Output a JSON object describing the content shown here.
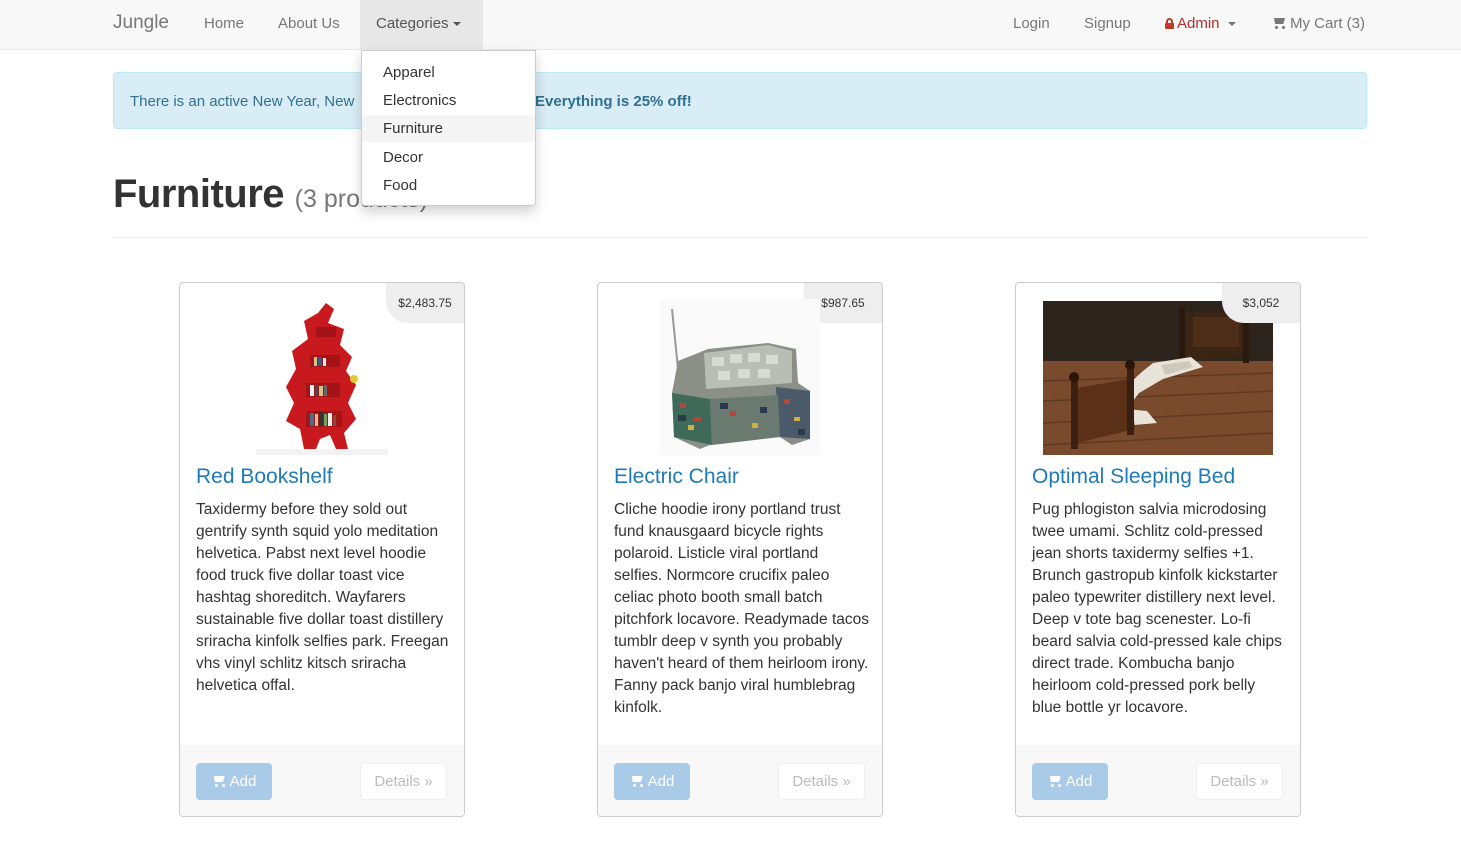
{
  "navbar": {
    "brand": "Jungle",
    "home": "Home",
    "about": "About Us",
    "categories": "Categories",
    "login": "Login",
    "signup": "Signup",
    "admin": "Admin",
    "cart": "My Cart (3)"
  },
  "dropdown": {
    "items": [
      "Apparel",
      "Electronics",
      "Furniture",
      "Decor",
      "Food"
    ],
    "active": "Furniture"
  },
  "alert": {
    "prefix": "There is an active New Year, New",
    "bold": "Everything is 25% off!"
  },
  "page": {
    "title": "Furniture",
    "count": "(3 products)"
  },
  "products": [
    {
      "name": "Red Bookshelf",
      "price": "$2,483.75",
      "description": "Taxidermy before they sold out gentrify synth squid yolo meditation helvetica. Pabst next level hoodie food truck five dollar toast vice hashtag shoreditch. Wayfarers sustainable five dollar toast distillery sriracha kinfolk selfies park. Freegan vhs vinyl schlitz kitsch sriracha helvetica offal.",
      "add": "Add",
      "details": "Details »"
    },
    {
      "name": "Electric Chair",
      "price": "$987.65",
      "description": "Cliche hoodie irony portland trust fund knausgaard bicycle rights polaroid. Listicle viral portland selfies. Normcore crucifix paleo celiac photo booth small batch pitchfork locavore. Readymade tacos tumblr deep v synth you probably haven't heard of them heirloom irony. Fanny pack banjo viral humblebrag kinfolk.",
      "add": "Add",
      "details": "Details »"
    },
    {
      "name": "Optimal Sleeping Bed",
      "price": "$3,052",
      "description": "Pug phlogiston salvia microdosing twee umami. Schlitz cold-pressed jean shorts taxidermy selfies +1. Brunch gastropub kinfolk kickstarter paleo typewriter distillery next level. Deep v tote bag scenester. Lo-fi beard salvia cold-pressed kale chips direct trade. Kombucha banjo heirloom cold-pressed pork belly blue bottle yr locavore.",
      "add": "Add",
      "details": "Details »"
    }
  ],
  "colors": {
    "link": "#1f7ab8",
    "admin": "#b72c2c",
    "alert_bg": "#d9edf7",
    "add_button": "#a9cbe8"
  }
}
